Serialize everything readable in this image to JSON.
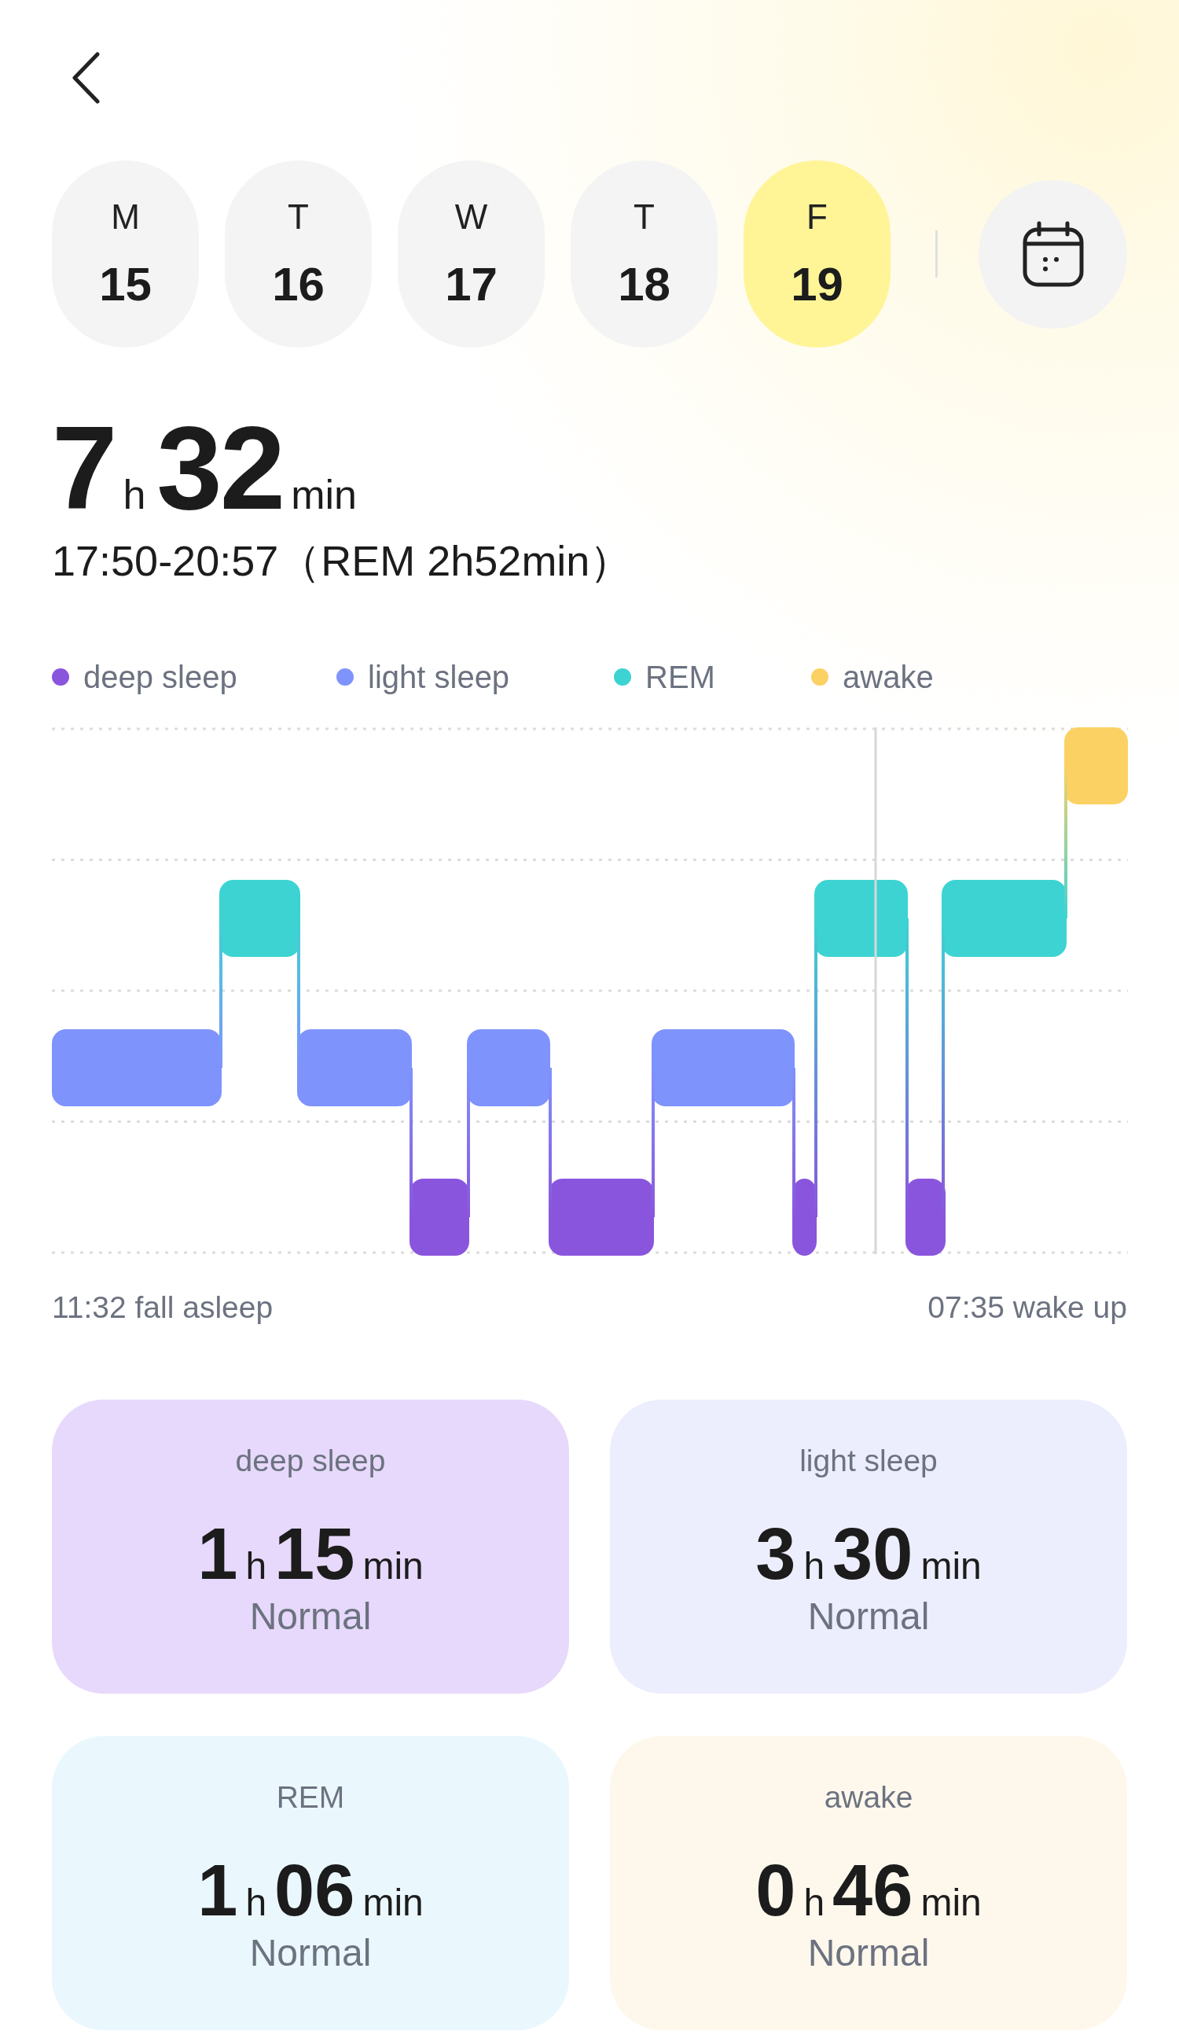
{
  "days": [
    {
      "weekday": "M",
      "date": "15",
      "selected": false
    },
    {
      "weekday": "T",
      "date": "16",
      "selected": false
    },
    {
      "weekday": "W",
      "date": "17",
      "selected": false
    },
    {
      "weekday": "T",
      "date": "18",
      "selected": false
    },
    {
      "weekday": "F",
      "date": "19",
      "selected": true
    }
  ],
  "total": {
    "hours": "7",
    "h_unit": "h",
    "minutes": "32",
    "min_unit": "min",
    "range": "17:50-20:57（REM 2h52min）"
  },
  "legend": [
    {
      "label": "deep sleep",
      "color": "#8a55dd"
    },
    {
      "label": "light sleep",
      "color": "#7f93fd"
    },
    {
      "label": "REM",
      "color": "#3dd3d3"
    },
    {
      "label": "awake",
      "color": "#fcd163"
    }
  ],
  "chart": {
    "start_label": "11:32 fall asleep",
    "end_label": "07:35 wake up"
  },
  "cards": [
    {
      "label": "deep sleep",
      "hours": "1",
      "h_unit": "h",
      "minutes": "15",
      "min_unit": "min",
      "status": "Normal",
      "color": "#e7d9fb"
    },
    {
      "label": "light sleep",
      "hours": "3",
      "h_unit": "h",
      "minutes": "30",
      "min_unit": "min",
      "status": "Normal",
      "color": "#eceefd"
    },
    {
      "label": "REM",
      "hours": "1",
      "h_unit": "h",
      "minutes": "06",
      "min_unit": "min",
      "status": "Normal",
      "color": "#eaf8fd"
    },
    {
      "label": "awake",
      "hours": "0",
      "h_unit": "h",
      "minutes": "46",
      "min_unit": "min",
      "status": "Normal",
      "color": "#fef8ec"
    }
  ]
}
